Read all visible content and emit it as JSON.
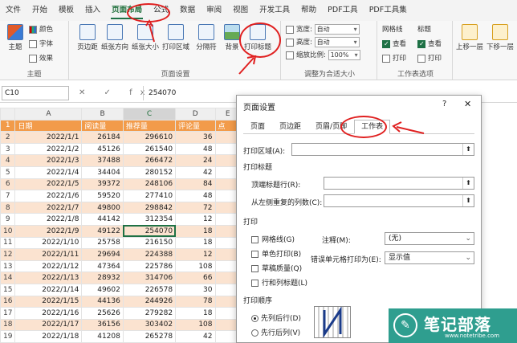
{
  "ribbon": {
    "tabs": [
      "文件",
      "开始",
      "模板",
      "插入",
      "页面布局",
      "公式",
      "数据",
      "审阅",
      "视图",
      "开发工具",
      "帮助",
      "PDF工具",
      "PDF工具集"
    ],
    "groups": {
      "theme": {
        "label": "主题",
        "btn_theme": "主题",
        "colors": "颜色",
        "fonts": "字体",
        "effects": "效果"
      },
      "page_setup": {
        "label": "页面设置",
        "margins": "页边距",
        "orientation": "纸张方向",
        "size": "纸张大小",
        "print_area": "打印区域",
        "breaks": "分隔符",
        "background": "背景",
        "print_titles": "打印标题"
      },
      "scale": {
        "label": "调整为合适大小",
        "width": "宽度:",
        "width_val": "自动",
        "height": "高度:",
        "height_val": "自动",
        "scale": "缩放比例:",
        "scale_val": "100%"
      },
      "sheet_options": {
        "label": "工作表选项",
        "gridlines": "网格线",
        "headings": "标题",
        "view": "查看",
        "print": "打印"
      },
      "arrange": {
        "bring_forward": "上移一层",
        "send_backward": "下移一层"
      }
    }
  },
  "formula_bar": {
    "name_box": "C10",
    "icons": "✕ ✓ fx",
    "value": "254070"
  },
  "sheet": {
    "col_headers": [
      "A",
      "B",
      "C",
      "D",
      "E"
    ],
    "header_row": [
      "日期",
      "阅读量",
      "推荐量",
      "评论量",
      "点"
    ],
    "rows": [
      [
        "2022/1/1",
        "26184",
        "296610",
        "36"
      ],
      [
        "2022/1/2",
        "45126",
        "261540",
        "48"
      ],
      [
        "2022/1/3",
        "37488",
        "266472",
        "24"
      ],
      [
        "2022/1/4",
        "34404",
        "280152",
        "42"
      ],
      [
        "2022/1/5",
        "39372",
        "248106",
        "84"
      ],
      [
        "2022/1/6",
        "59520",
        "277410",
        "48"
      ],
      [
        "2022/1/7",
        "49800",
        "298842",
        "72"
      ],
      [
        "2022/1/8",
        "44142",
        "312354",
        "12"
      ],
      [
        "2022/1/9",
        "49122",
        "254070",
        "18"
      ],
      [
        "2022/1/10",
        "25758",
        "216150",
        "18"
      ],
      [
        "2022/1/11",
        "29694",
        "224388",
        "12"
      ],
      [
        "2022/1/12",
        "47364",
        "225786",
        "108"
      ],
      [
        "2022/1/13",
        "28932",
        "314706",
        "66"
      ],
      [
        "2022/1/14",
        "49602",
        "226578",
        "30"
      ],
      [
        "2022/1/15",
        "44136",
        "244926",
        "78"
      ],
      [
        "2022/1/16",
        "25626",
        "279282",
        "18"
      ],
      [
        "2022/1/17",
        "36156",
        "303402",
        "108"
      ],
      [
        "2022/1/18",
        "41208",
        "265278",
        "42"
      ]
    ]
  },
  "dialog": {
    "title": "页面设置",
    "help": "?",
    "close": "✕",
    "tabs": [
      "页面",
      "页边距",
      "页眉/页脚",
      "工作表"
    ],
    "print_area_label": "打印区域(A):",
    "print_titles_section": "打印标题",
    "rows_repeat_label": "顶端标题行(R):",
    "cols_repeat_label": "从左侧重复的列数(C):",
    "print_section": "打印",
    "gridlines": "网格线(G)",
    "bw": "单色打印(B)",
    "draft": "草稿质量(Q)",
    "row_col_headings": "行和列标题(L)",
    "comments_label": "注释(M):",
    "comments_value": "(无)",
    "errors_label": "错误单元格打印为(E):",
    "errors_value": "显示值",
    "order_section": "打印顺序",
    "down_then_over": "先列后行(D)",
    "over_then_down": "先行后列(V)"
  },
  "watermark": {
    "logo": "✎",
    "text": "笔记部落",
    "url": "www.notetribe.com"
  }
}
